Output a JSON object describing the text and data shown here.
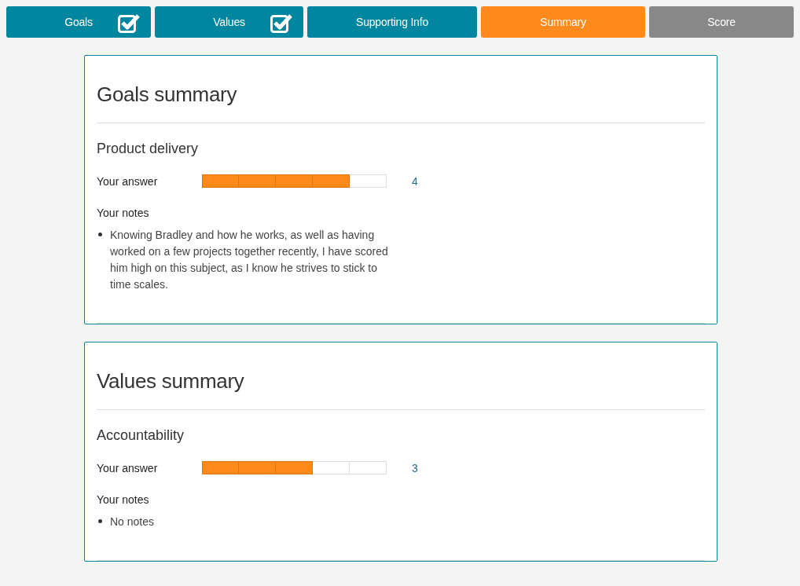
{
  "tabs": [
    {
      "label": "Goals",
      "selected": false,
      "completed": true,
      "disabled": false
    },
    {
      "label": "Values",
      "selected": false,
      "completed": true,
      "disabled": false
    },
    {
      "label": "Supporting Info",
      "selected": false,
      "completed": false,
      "disabled": false
    },
    {
      "label": "Summary",
      "selected": true,
      "completed": false,
      "disabled": false
    },
    {
      "label": "Score",
      "selected": false,
      "completed": false,
      "disabled": true
    }
  ],
  "sections": [
    {
      "title": "Goals summary",
      "items": [
        {
          "name": "Product delivery",
          "answer_label": "Your answer",
          "level": 0.8,
          "score": "4",
          "notes_label": "Your notes",
          "notes": [
            "Knowing Bradley and how he works, as well as having worked on a few projects together recently, I have scored him high on this subject, as I know he strives to stick to time scales."
          ]
        }
      ]
    },
    {
      "title": "Values summary",
      "items": [
        {
          "name": "Accountability",
          "answer_label": "Your answer",
          "level": 0.6,
          "score": "3",
          "notes_label": "Your notes",
          "notes": [
            "No notes"
          ]
        }
      ]
    }
  ]
}
